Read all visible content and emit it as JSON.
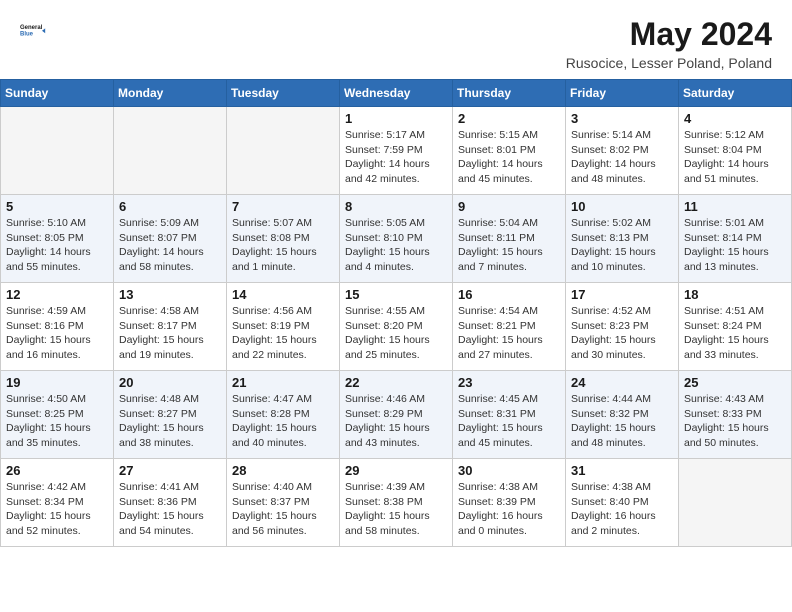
{
  "header": {
    "logo_general": "General",
    "logo_blue": "Blue",
    "title": "May 2024",
    "subtitle": "Rusocice, Lesser Poland, Poland"
  },
  "days_of_week": [
    "Sunday",
    "Monday",
    "Tuesday",
    "Wednesday",
    "Thursday",
    "Friday",
    "Saturday"
  ],
  "weeks": [
    {
      "days": [
        {
          "num": "",
          "info": ""
        },
        {
          "num": "",
          "info": ""
        },
        {
          "num": "",
          "info": ""
        },
        {
          "num": "1",
          "info": "Sunrise: 5:17 AM\nSunset: 7:59 PM\nDaylight: 14 hours and 42 minutes."
        },
        {
          "num": "2",
          "info": "Sunrise: 5:15 AM\nSunset: 8:01 PM\nDaylight: 14 hours and 45 minutes."
        },
        {
          "num": "3",
          "info": "Sunrise: 5:14 AM\nSunset: 8:02 PM\nDaylight: 14 hours and 48 minutes."
        },
        {
          "num": "4",
          "info": "Sunrise: 5:12 AM\nSunset: 8:04 PM\nDaylight: 14 hours and 51 minutes."
        }
      ]
    },
    {
      "days": [
        {
          "num": "5",
          "info": "Sunrise: 5:10 AM\nSunset: 8:05 PM\nDaylight: 14 hours and 55 minutes."
        },
        {
          "num": "6",
          "info": "Sunrise: 5:09 AM\nSunset: 8:07 PM\nDaylight: 14 hours and 58 minutes."
        },
        {
          "num": "7",
          "info": "Sunrise: 5:07 AM\nSunset: 8:08 PM\nDaylight: 15 hours and 1 minute."
        },
        {
          "num": "8",
          "info": "Sunrise: 5:05 AM\nSunset: 8:10 PM\nDaylight: 15 hours and 4 minutes."
        },
        {
          "num": "9",
          "info": "Sunrise: 5:04 AM\nSunset: 8:11 PM\nDaylight: 15 hours and 7 minutes."
        },
        {
          "num": "10",
          "info": "Sunrise: 5:02 AM\nSunset: 8:13 PM\nDaylight: 15 hours and 10 minutes."
        },
        {
          "num": "11",
          "info": "Sunrise: 5:01 AM\nSunset: 8:14 PM\nDaylight: 15 hours and 13 minutes."
        }
      ]
    },
    {
      "days": [
        {
          "num": "12",
          "info": "Sunrise: 4:59 AM\nSunset: 8:16 PM\nDaylight: 15 hours and 16 minutes."
        },
        {
          "num": "13",
          "info": "Sunrise: 4:58 AM\nSunset: 8:17 PM\nDaylight: 15 hours and 19 minutes."
        },
        {
          "num": "14",
          "info": "Sunrise: 4:56 AM\nSunset: 8:19 PM\nDaylight: 15 hours and 22 minutes."
        },
        {
          "num": "15",
          "info": "Sunrise: 4:55 AM\nSunset: 8:20 PM\nDaylight: 15 hours and 25 minutes."
        },
        {
          "num": "16",
          "info": "Sunrise: 4:54 AM\nSunset: 8:21 PM\nDaylight: 15 hours and 27 minutes."
        },
        {
          "num": "17",
          "info": "Sunrise: 4:52 AM\nSunset: 8:23 PM\nDaylight: 15 hours and 30 minutes."
        },
        {
          "num": "18",
          "info": "Sunrise: 4:51 AM\nSunset: 8:24 PM\nDaylight: 15 hours and 33 minutes."
        }
      ]
    },
    {
      "days": [
        {
          "num": "19",
          "info": "Sunrise: 4:50 AM\nSunset: 8:25 PM\nDaylight: 15 hours and 35 minutes."
        },
        {
          "num": "20",
          "info": "Sunrise: 4:48 AM\nSunset: 8:27 PM\nDaylight: 15 hours and 38 minutes."
        },
        {
          "num": "21",
          "info": "Sunrise: 4:47 AM\nSunset: 8:28 PM\nDaylight: 15 hours and 40 minutes."
        },
        {
          "num": "22",
          "info": "Sunrise: 4:46 AM\nSunset: 8:29 PM\nDaylight: 15 hours and 43 minutes."
        },
        {
          "num": "23",
          "info": "Sunrise: 4:45 AM\nSunset: 8:31 PM\nDaylight: 15 hours and 45 minutes."
        },
        {
          "num": "24",
          "info": "Sunrise: 4:44 AM\nSunset: 8:32 PM\nDaylight: 15 hours and 48 minutes."
        },
        {
          "num": "25",
          "info": "Sunrise: 4:43 AM\nSunset: 8:33 PM\nDaylight: 15 hours and 50 minutes."
        }
      ]
    },
    {
      "days": [
        {
          "num": "26",
          "info": "Sunrise: 4:42 AM\nSunset: 8:34 PM\nDaylight: 15 hours and 52 minutes."
        },
        {
          "num": "27",
          "info": "Sunrise: 4:41 AM\nSunset: 8:36 PM\nDaylight: 15 hours and 54 minutes."
        },
        {
          "num": "28",
          "info": "Sunrise: 4:40 AM\nSunset: 8:37 PM\nDaylight: 15 hours and 56 minutes."
        },
        {
          "num": "29",
          "info": "Sunrise: 4:39 AM\nSunset: 8:38 PM\nDaylight: 15 hours and 58 minutes."
        },
        {
          "num": "30",
          "info": "Sunrise: 4:38 AM\nSunset: 8:39 PM\nDaylight: 16 hours and 0 minutes."
        },
        {
          "num": "31",
          "info": "Sunrise: 4:38 AM\nSunset: 8:40 PM\nDaylight: 16 hours and 2 minutes."
        },
        {
          "num": "",
          "info": ""
        }
      ]
    }
  ]
}
